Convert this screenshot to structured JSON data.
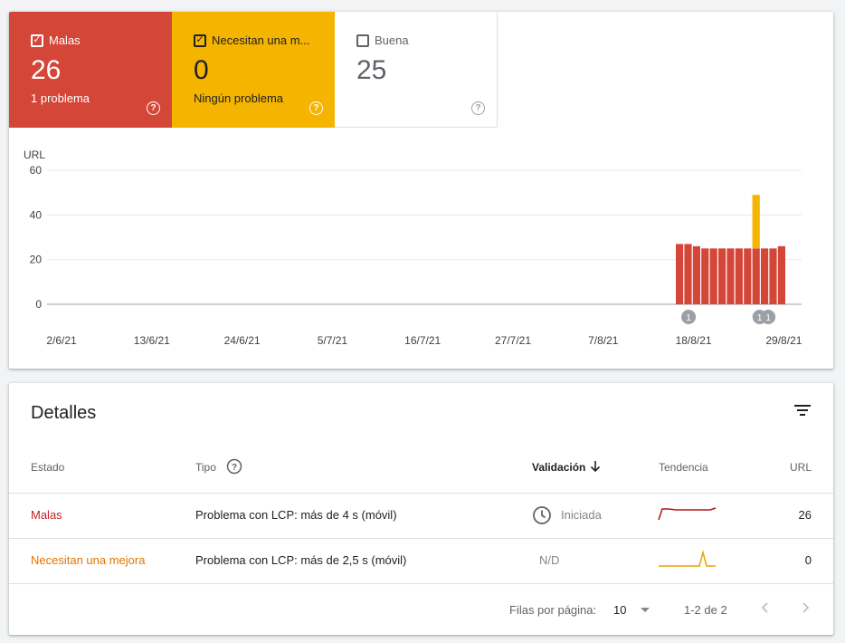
{
  "tiles": {
    "bad": {
      "label": "Malas",
      "count": "26",
      "sub": "1 problema",
      "checked": true,
      "color": "#d44638"
    },
    "needs": {
      "label": "Necesitan una m...",
      "count": "0",
      "sub": "Ningún problema",
      "checked": true,
      "color": "#f4b400"
    },
    "good": {
      "label": "Buena",
      "count": "25",
      "sub": "",
      "checked": false
    }
  },
  "help_glyph": "?",
  "chart_data": {
    "type": "bar",
    "ylabel": "URL",
    "ylim": [
      0,
      60
    ],
    "yticks": [
      "60",
      "40",
      "20",
      "0"
    ],
    "xtick_labels": [
      "2/6/21",
      "13/6/21",
      "24/6/21",
      "5/7/21",
      "16/7/21",
      "27/7/21",
      "7/8/21",
      "18/8/21",
      "29/8/21"
    ],
    "categories": [
      "17/8/21",
      "18/8/21",
      "19/8/21",
      "20/8/21",
      "21/8/21",
      "22/8/21",
      "23/8/21",
      "24/8/21",
      "25/8/21",
      "26/8/21",
      "27/8/21",
      "28/8/21",
      "29/8/21"
    ],
    "series": [
      {
        "name": "Malas",
        "color": "#d44638",
        "values": [
          27,
          27,
          26,
          25,
          25,
          25,
          25,
          25,
          25,
          25,
          25,
          25,
          26
        ]
      },
      {
        "name": "Necesitan una mejora",
        "color": "#f4b400",
        "values": [
          0,
          0,
          0,
          0,
          0,
          0,
          0,
          0,
          0,
          24,
          0,
          0,
          0
        ]
      }
    ],
    "annotations": [
      {
        "label": "1",
        "category": "17/8/21"
      },
      {
        "label": "1",
        "category": "26/8/21"
      },
      {
        "label": "1",
        "category": "27/8/21"
      }
    ]
  },
  "details": {
    "title": "Detalles",
    "headers": {
      "estado": "Estado",
      "tipo": "Tipo",
      "validacion": "Validación",
      "tendencia": "Tendencia",
      "url": "URL"
    },
    "rows": [
      {
        "estado": "Malas",
        "estado_color": "#c5221f",
        "tipo": "Problema con LCP: más de 4 s (móvil)",
        "validacion": "Iniciada",
        "url": "26",
        "trend_color": "#b31412"
      },
      {
        "estado": "Necesitan una mejora",
        "estado_color": "#e37400",
        "tipo": "Problema con LCP: más de 2,5 s (móvil)",
        "validacion": "N/D",
        "url": "0",
        "trend_color": "#e8a300"
      }
    ],
    "pager": {
      "rows_label": "Filas por página:",
      "rows_value": "10",
      "range": "1-2 de 2"
    }
  }
}
